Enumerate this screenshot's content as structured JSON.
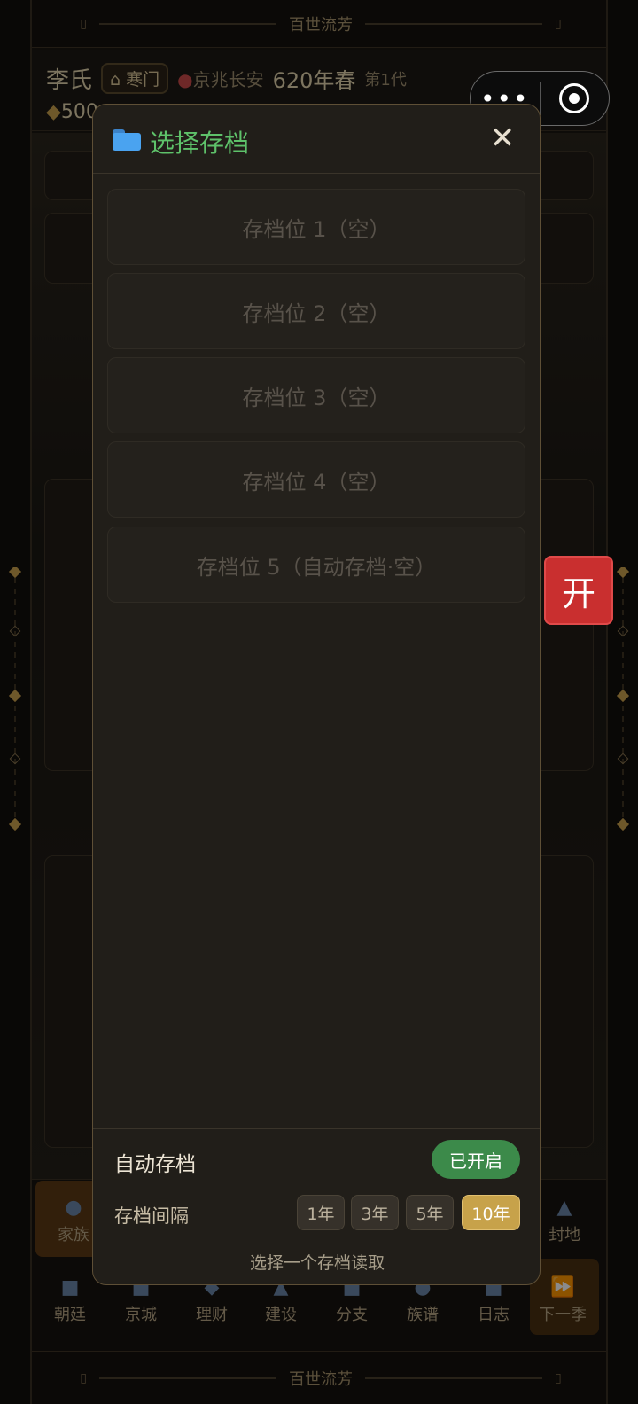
{
  "app": {
    "banner_title": "百世流芳",
    "banner_bracket_left": "▯",
    "banner_bracket_right": "▯"
  },
  "header": {
    "clan_name": "李氏",
    "rank_tag": "寒门",
    "location": "京兆长安",
    "season": "620年春",
    "generation": "第1代",
    "money_partial": "500"
  },
  "floating_button": {
    "label": "开"
  },
  "capsule": {
    "more_icon": "more-dots-icon",
    "close_icon": "target-ring-icon"
  },
  "modal": {
    "title": "选择存档",
    "title_icon": "folder-icon",
    "close_label": "✕",
    "slots": [
      "存档位 1（空）",
      "存档位 2（空）",
      "存档位 3（空）",
      "存档位 4（空）",
      "存档位 5（自动存档·空）"
    ],
    "auto_save_label": "自动存档",
    "auto_save_state": "已开启",
    "interval_label": "存档间隔",
    "interval_options": [
      "1年",
      "3年",
      "5年",
      "10年"
    ],
    "interval_selected": "10年",
    "hint": "选择一个存档读取"
  },
  "nav_top": {
    "items": [
      "家族",
      "封地"
    ]
  },
  "nav_bottom": {
    "items": [
      "朝廷",
      "京城",
      "理财",
      "建设",
      "分支",
      "族谱",
      "日志",
      "下一季"
    ]
  },
  "colors": {
    "accent_green": "#5ec26a",
    "toggle_green": "#3c8a4a",
    "selected_gold": "#c7a24a",
    "kai_red": "#c92f2f"
  }
}
